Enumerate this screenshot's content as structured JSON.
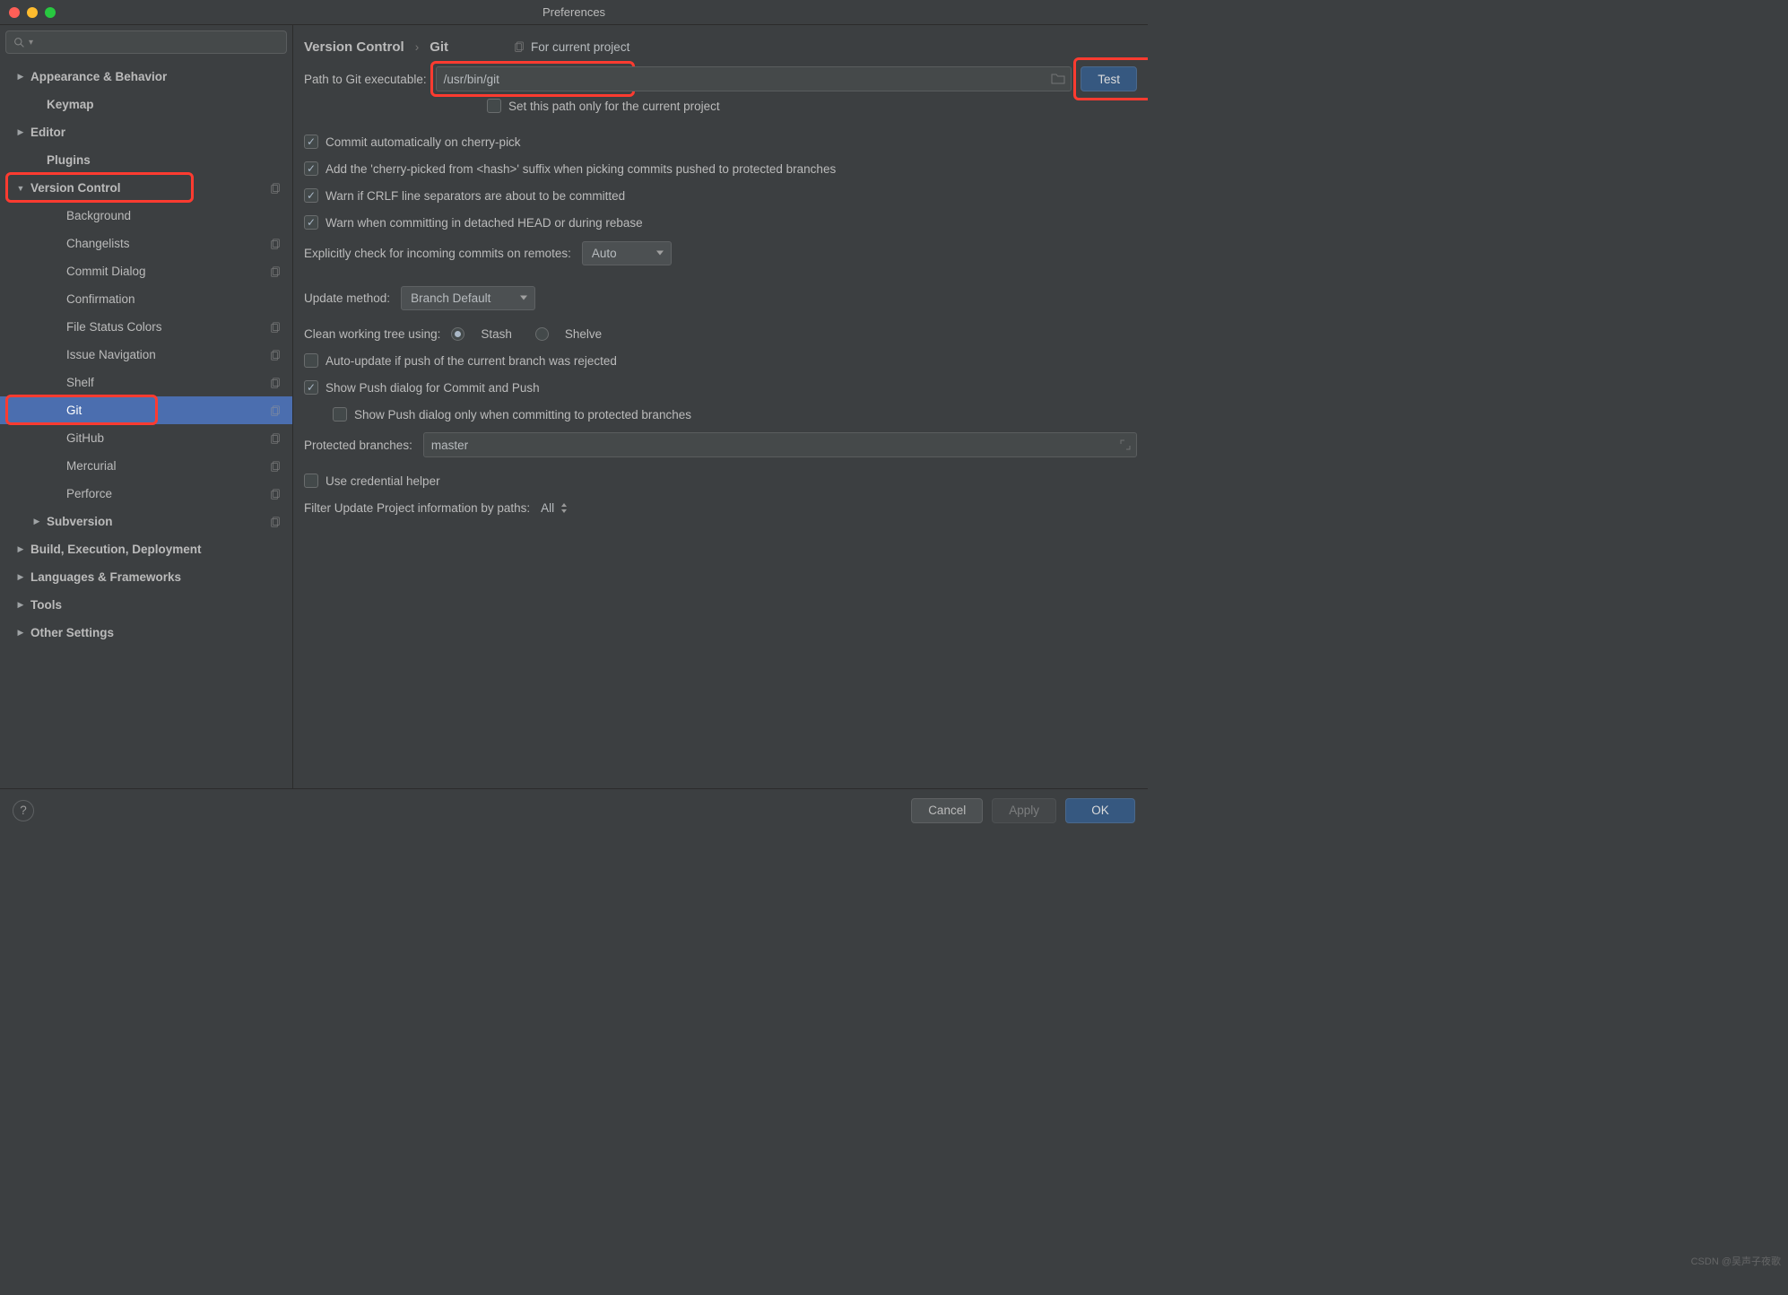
{
  "window": {
    "title": "Preferences"
  },
  "search": {
    "placeholder": ""
  },
  "sidebar": {
    "items": [
      {
        "label": "Appearance & Behavior",
        "indent": 18,
        "arrow": "right",
        "bold": true
      },
      {
        "label": "Keymap",
        "indent": 36,
        "arrow": "none",
        "bold": true
      },
      {
        "label": "Editor",
        "indent": 18,
        "arrow": "right",
        "bold": true
      },
      {
        "label": "Plugins",
        "indent": 36,
        "arrow": "none",
        "bold": true
      },
      {
        "label": "Version Control",
        "indent": 18,
        "arrow": "down",
        "bold": true,
        "copy": true,
        "highlight": true
      },
      {
        "label": "Background",
        "indent": 58,
        "arrow": "none",
        "sub": true
      },
      {
        "label": "Changelists",
        "indent": 58,
        "arrow": "none",
        "sub": true,
        "copy": true
      },
      {
        "label": "Commit Dialog",
        "indent": 58,
        "arrow": "none",
        "sub": true,
        "copy": true
      },
      {
        "label": "Confirmation",
        "indent": 58,
        "arrow": "none",
        "sub": true
      },
      {
        "label": "File Status Colors",
        "indent": 58,
        "arrow": "none",
        "sub": true,
        "copy": true
      },
      {
        "label": "Issue Navigation",
        "indent": 58,
        "arrow": "none",
        "sub": true,
        "copy": true
      },
      {
        "label": "Shelf",
        "indent": 58,
        "arrow": "none",
        "sub": true,
        "copy": true
      },
      {
        "label": "Git",
        "indent": 58,
        "arrow": "none",
        "sub": true,
        "copy": true,
        "selected": true,
        "highlight": true
      },
      {
        "label": "GitHub",
        "indent": 58,
        "arrow": "none",
        "sub": true,
        "copy": true
      },
      {
        "label": "Mercurial",
        "indent": 58,
        "arrow": "none",
        "sub": true,
        "copy": true
      },
      {
        "label": "Perforce",
        "indent": 58,
        "arrow": "none",
        "sub": true,
        "copy": true
      },
      {
        "label": "Subversion",
        "indent": 36,
        "arrow": "right",
        "bold": true,
        "copy": true
      },
      {
        "label": "Build, Execution, Deployment",
        "indent": 18,
        "arrow": "right",
        "bold": true
      },
      {
        "label": "Languages & Frameworks",
        "indent": 18,
        "arrow": "right",
        "bold": true
      },
      {
        "label": "Tools",
        "indent": 18,
        "arrow": "right",
        "bold": true
      },
      {
        "label": "Other Settings",
        "indent": 18,
        "arrow": "right",
        "bold": true
      }
    ]
  },
  "breadcrumb": {
    "seg1": "Version Control",
    "seg2": "Git",
    "scope": "For current project"
  },
  "main": {
    "path_label": "Path to Git executable:",
    "path_value": "/usr/bin/git",
    "test_button": "Test",
    "set_path_project": "Set this path only for the current project",
    "chk_commit_cherry": "Commit automatically on cherry-pick",
    "chk_cherry_suffix": "Add the 'cherry-picked from <hash>' suffix when picking commits pushed to protected branches",
    "chk_crlf": "Warn if CRLF line separators are about to be committed",
    "chk_detached": "Warn when committing in detached HEAD or during rebase",
    "incoming_label": "Explicitly check for incoming commits on remotes:",
    "incoming_value": "Auto",
    "update_label": "Update method:",
    "update_value": "Branch Default",
    "clean_label": "Clean working tree using:",
    "clean_stash": "Stash",
    "clean_shelve": "Shelve",
    "chk_autoupdate": "Auto-update if push of the current branch was rejected",
    "chk_show_push": "Show Push dialog for Commit and Push",
    "chk_show_push_protected": "Show Push dialog only when committing to protected branches",
    "protected_label": "Protected branches:",
    "protected_value": "master",
    "chk_cred": "Use credential helper",
    "filter_label": "Filter Update Project information by paths:",
    "filter_value": "All"
  },
  "footer": {
    "cancel": "Cancel",
    "apply": "Apply",
    "ok": "OK"
  },
  "watermark": "CSDN @吴声子夜歌"
}
